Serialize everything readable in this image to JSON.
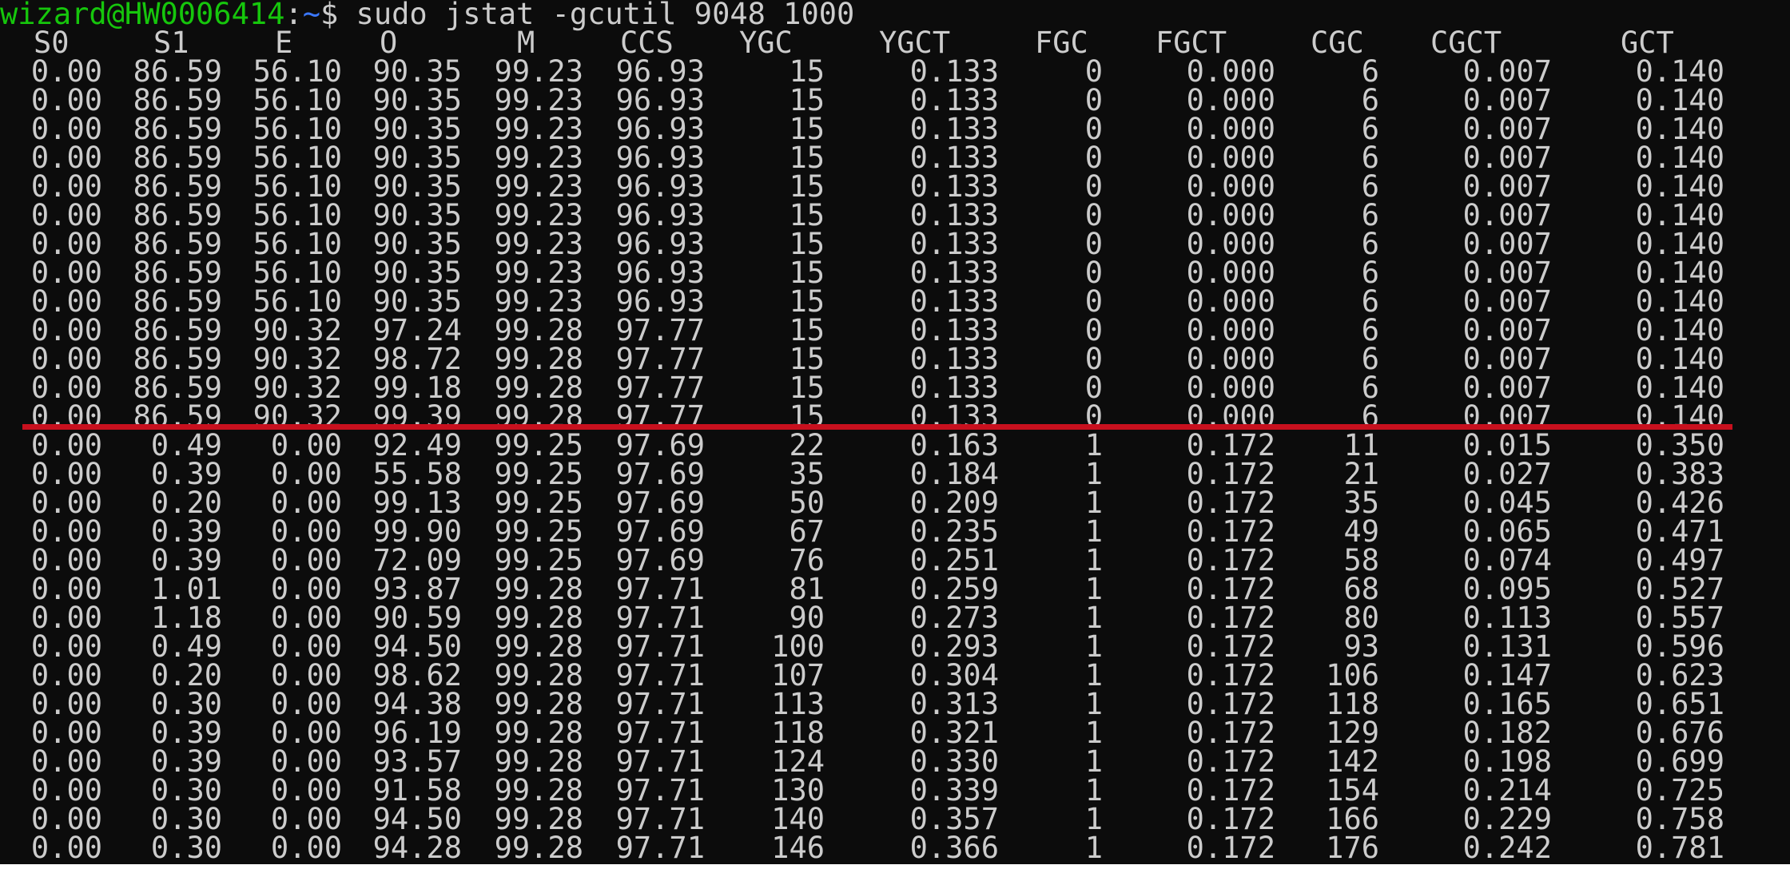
{
  "prompt": {
    "user_host": "wizard@HW0006414",
    "colon": ":",
    "path": "~",
    "symbol": "$",
    "command": "sudo jstat -gcutil 9048 1000"
  },
  "colors": {
    "background": "#0c0c0c",
    "text": "#cccccc",
    "prompt_user": "#16c60c",
    "prompt_path": "#3b78ff",
    "annotation_line": "#c8101e"
  },
  "headers": [
    "S0",
    "S1",
    "E",
    "O",
    "M",
    "CCS",
    "YGC",
    "YGCT",
    "FGC",
    "FGCT",
    "CGC",
    "CGCT",
    "GCT"
  ],
  "rows": [
    [
      "0.00",
      "86.59",
      "56.10",
      "90.35",
      "99.23",
      "96.93",
      "15",
      "0.133",
      "0",
      "0.000",
      "6",
      "0.007",
      "0.140"
    ],
    [
      "0.00",
      "86.59",
      "56.10",
      "90.35",
      "99.23",
      "96.93",
      "15",
      "0.133",
      "0",
      "0.000",
      "6",
      "0.007",
      "0.140"
    ],
    [
      "0.00",
      "86.59",
      "56.10",
      "90.35",
      "99.23",
      "96.93",
      "15",
      "0.133",
      "0",
      "0.000",
      "6",
      "0.007",
      "0.140"
    ],
    [
      "0.00",
      "86.59",
      "56.10",
      "90.35",
      "99.23",
      "96.93",
      "15",
      "0.133",
      "0",
      "0.000",
      "6",
      "0.007",
      "0.140"
    ],
    [
      "0.00",
      "86.59",
      "56.10",
      "90.35",
      "99.23",
      "96.93",
      "15",
      "0.133",
      "0",
      "0.000",
      "6",
      "0.007",
      "0.140"
    ],
    [
      "0.00",
      "86.59",
      "56.10",
      "90.35",
      "99.23",
      "96.93",
      "15",
      "0.133",
      "0",
      "0.000",
      "6",
      "0.007",
      "0.140"
    ],
    [
      "0.00",
      "86.59",
      "56.10",
      "90.35",
      "99.23",
      "96.93",
      "15",
      "0.133",
      "0",
      "0.000",
      "6",
      "0.007",
      "0.140"
    ],
    [
      "0.00",
      "86.59",
      "56.10",
      "90.35",
      "99.23",
      "96.93",
      "15",
      "0.133",
      "0",
      "0.000",
      "6",
      "0.007",
      "0.140"
    ],
    [
      "0.00",
      "86.59",
      "56.10",
      "90.35",
      "99.23",
      "96.93",
      "15",
      "0.133",
      "0",
      "0.000",
      "6",
      "0.007",
      "0.140"
    ],
    [
      "0.00",
      "86.59",
      "90.32",
      "97.24",
      "99.28",
      "97.77",
      "15",
      "0.133",
      "0",
      "0.000",
      "6",
      "0.007",
      "0.140"
    ],
    [
      "0.00",
      "86.59",
      "90.32",
      "98.72",
      "99.28",
      "97.77",
      "15",
      "0.133",
      "0",
      "0.000",
      "6",
      "0.007",
      "0.140"
    ],
    [
      "0.00",
      "86.59",
      "90.32",
      "99.18",
      "99.28",
      "97.77",
      "15",
      "0.133",
      "0",
      "0.000",
      "6",
      "0.007",
      "0.140"
    ],
    [
      "0.00",
      "86.59",
      "90.32",
      "99.39",
      "99.28",
      "97.77",
      "15",
      "0.133",
      "0",
      "0.000",
      "6",
      "0.007",
      "0.140"
    ],
    [
      "0.00",
      "0.49",
      "0.00",
      "92.49",
      "99.25",
      "97.69",
      "22",
      "0.163",
      "1",
      "0.172",
      "11",
      "0.015",
      "0.350"
    ],
    [
      "0.00",
      "0.39",
      "0.00",
      "55.58",
      "99.25",
      "97.69",
      "35",
      "0.184",
      "1",
      "0.172",
      "21",
      "0.027",
      "0.383"
    ],
    [
      "0.00",
      "0.20",
      "0.00",
      "99.13",
      "99.25",
      "97.69",
      "50",
      "0.209",
      "1",
      "0.172",
      "35",
      "0.045",
      "0.426"
    ],
    [
      "0.00",
      "0.39",
      "0.00",
      "99.90",
      "99.25",
      "97.69",
      "67",
      "0.235",
      "1",
      "0.172",
      "49",
      "0.065",
      "0.471"
    ],
    [
      "0.00",
      "0.39",
      "0.00",
      "72.09",
      "99.25",
      "97.69",
      "76",
      "0.251",
      "1",
      "0.172",
      "58",
      "0.074",
      "0.497"
    ],
    [
      "0.00",
      "1.01",
      "0.00",
      "93.87",
      "99.28",
      "97.71",
      "81",
      "0.259",
      "1",
      "0.172",
      "68",
      "0.095",
      "0.527"
    ],
    [
      "0.00",
      "1.18",
      "0.00",
      "90.59",
      "99.28",
      "97.71",
      "90",
      "0.273",
      "1",
      "0.172",
      "80",
      "0.113",
      "0.557"
    ],
    [
      "0.00",
      "0.49",
      "0.00",
      "94.50",
      "99.28",
      "97.71",
      "100",
      "0.293",
      "1",
      "0.172",
      "93",
      "0.131",
      "0.596"
    ],
    [
      "0.00",
      "0.20",
      "0.00",
      "98.62",
      "99.28",
      "97.71",
      "107",
      "0.304",
      "1",
      "0.172",
      "106",
      "0.147",
      "0.623"
    ],
    [
      "0.00",
      "0.30",
      "0.00",
      "94.38",
      "99.28",
      "97.71",
      "113",
      "0.313",
      "1",
      "0.172",
      "118",
      "0.165",
      "0.651"
    ],
    [
      "0.00",
      "0.39",
      "0.00",
      "96.19",
      "99.28",
      "97.71",
      "118",
      "0.321",
      "1",
      "0.172",
      "129",
      "0.182",
      "0.676"
    ],
    [
      "0.00",
      "0.39",
      "0.00",
      "93.57",
      "99.28",
      "97.71",
      "124",
      "0.330",
      "1",
      "0.172",
      "142",
      "0.198",
      "0.699"
    ],
    [
      "0.00",
      "0.30",
      "0.00",
      "91.58",
      "99.28",
      "97.71",
      "130",
      "0.339",
      "1",
      "0.172",
      "154",
      "0.214",
      "0.725"
    ],
    [
      "0.00",
      "0.30",
      "0.00",
      "94.50",
      "99.28",
      "97.71",
      "140",
      "0.357",
      "1",
      "0.172",
      "166",
      "0.229",
      "0.758"
    ],
    [
      "0.00",
      "0.30",
      "0.00",
      "94.28",
      "99.28",
      "97.71",
      "146",
      "0.366",
      "1",
      "0.172",
      "176",
      "0.242",
      "0.781"
    ]
  ]
}
